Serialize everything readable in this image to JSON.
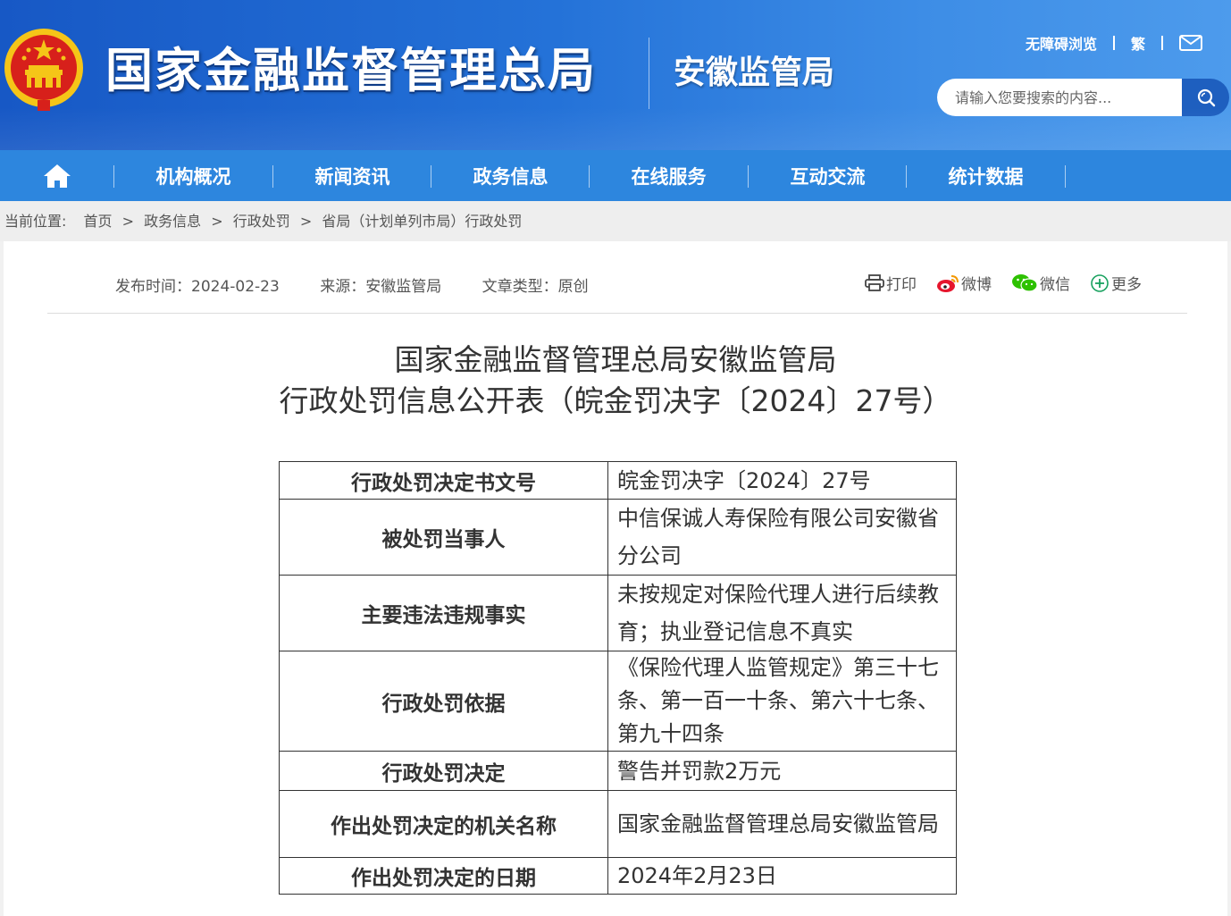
{
  "header": {
    "site_title": "国家金融监督管理总局",
    "sub_title": "安徽监管局",
    "accessibility_link": "无障碍浏览",
    "traditional_link": "繁",
    "search_placeholder": "请输入您要搜索的内容..."
  },
  "nav": {
    "items": [
      "机构概况",
      "新闻资讯",
      "政务信息",
      "在线服务",
      "互动交流",
      "统计数据"
    ]
  },
  "breadcrumb": {
    "label": "当前位置:",
    "items": [
      "首页",
      "政务信息",
      "行政处罚",
      "省局（计划单列市局）行政处罚"
    ],
    "separator": ">"
  },
  "meta": {
    "publish": "发布时间：2024-02-23",
    "source": "来源：安徽监管局",
    "type": "文章类型：原创"
  },
  "share": {
    "print": "打印",
    "weibo": "微博",
    "wechat": "微信",
    "more": "更多"
  },
  "document": {
    "title_line1": "国家金融监督管理总局安徽监管局",
    "title_line2": "行政处罚信息公开表（皖金罚决字〔2024〕27号）"
  },
  "penalty_table": [
    {
      "key": "行政处罚决定书文号",
      "value": "皖金罚决字〔2024〕27号"
    },
    {
      "key": "被处罚当事人",
      "value": "中信保诚人寿保险有限公司安徽省分公司"
    },
    {
      "key": "主要违法违规事实",
      "value": "未按规定对保险代理人进行后续教育；执业登记信息不真实"
    },
    {
      "key": "行政处罚依据",
      "value": "《保险代理人监管规定》第三十七条、第一百一十条、第六十七条、第九十四条"
    },
    {
      "key": "行政处罚决定",
      "value": "警告并罚款2万元"
    },
    {
      "key": "作出处罚决定的机关名称",
      "value": "国家金融监督管理总局安徽监管局"
    },
    {
      "key": "作出处罚决定的日期",
      "value": "2024年2月23日"
    }
  ],
  "colors": {
    "header_blue": "#2472d8",
    "nav_blue": "#2d86de",
    "emblem_red": "#d7201b",
    "emblem_gold": "#f5c518"
  }
}
